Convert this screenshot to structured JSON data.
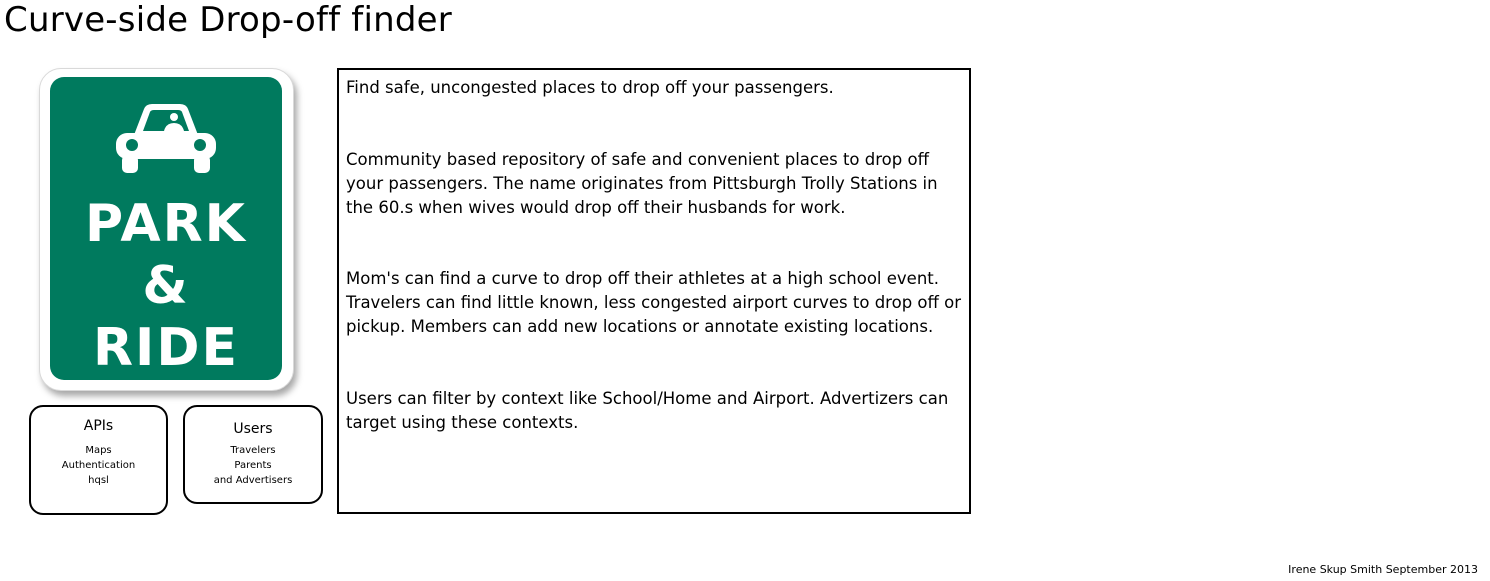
{
  "page_title": "Curve-side Drop-off finder",
  "sign": {
    "line1": "PARK",
    "line2": "&",
    "line3": "RIDE",
    "icon": "car-with-driver-icon",
    "color": "#007a5e"
  },
  "apis_card": {
    "title": "APIs",
    "items": [
      "Maps",
      "Authentication",
      "hqsl"
    ]
  },
  "users_card": {
    "title": "Users",
    "items": [
      "Travelers",
      "Parents",
      "and Advertisers"
    ]
  },
  "description": {
    "paragraphs": [
      "Find safe, uncongested places to drop off your passengers.",
      "Community based repository of safe and convenient places to drop off your passengers. The name originates  from Pittsburgh Trolly Stations in the 60.s when wives would drop off their husbands for work.",
      "Mom's can find a curve to drop off their athletes at a high school event. Travelers can find little known, less congested airport curves to drop off or pickup. Members can add new locations or annotate existing locations.",
      "Users can filter by context like School/Home and Airport. Advertizers can target using these contexts."
    ]
  },
  "footer": "Irene Skup Smith September 2013"
}
